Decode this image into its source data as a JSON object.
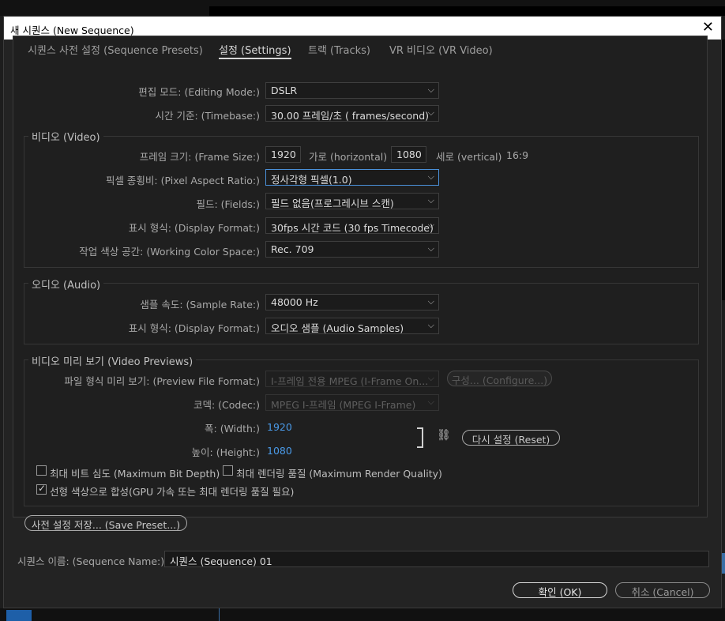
{
  "window": {
    "title": "새 시퀀스 (New Sequence)"
  },
  "tabs": [
    {
      "label": "시퀀스 사전 설정 (Sequence Presets)",
      "active": false
    },
    {
      "label": "설정 (Settings)",
      "active": true
    },
    {
      "label": "트랙 (Tracks)",
      "active": false
    },
    {
      "label": "VR 비디오 (VR Video)",
      "active": false
    }
  ],
  "general": {
    "editing_mode_label": "편집 모드: (Editing Mode:)",
    "editing_mode_value": "DSLR",
    "timebase_label": "시간 기준: (Timebase:)",
    "timebase_value": "30.00 프레임/초 ( frames/second)"
  },
  "video": {
    "title": "비디오 (Video)",
    "frame_size_label": "프레임 크기: (Frame Size:)",
    "frame_width": "1920",
    "horizontal_label": "가로 (horizontal)",
    "frame_height": "1080",
    "vertical_label": "세로 (vertical)",
    "aspect": "16:9",
    "par_label": "픽셀 종횡비: (Pixel Aspect Ratio:)",
    "par_value": "정사각형 픽셀(1.0)",
    "fields_label": "필드: (Fields:)",
    "fields_value": "필드 없음(프로그레시브 스캔)",
    "display_format_label": "표시 형식: (Display Format:)",
    "display_format_value": "30fps 시간 코드 (30 fps Timecode)",
    "color_space_label": "작업 색상 공간: (Working Color Space:)",
    "color_space_value": "Rec. 709"
  },
  "audio": {
    "title": "오디오 (Audio)",
    "sample_rate_label": "샘플 속도: (Sample Rate:)",
    "sample_rate_value": "48000 Hz",
    "display_format_label": "표시 형식: (Display Format:)",
    "display_format_value": "오디오 샘플 (Audio Samples)"
  },
  "previews": {
    "title": "비디오 미리 보기 (Video Previews)",
    "file_format_label": "파일 형식 미리 보기: (Preview File Format:)",
    "file_format_value": "I-프레임 전용 MPEG (I-Frame On...",
    "configure_label": "구성... (Configure...)",
    "codec_label": "코덱: (Codec:)",
    "codec_value": "MPEG I-프레임 (MPEG I-Frame)",
    "width_label": "폭: (Width:)",
    "width_value": "1920",
    "height_label": "높이: (Height:)",
    "height_value": "1080",
    "reset_label": "다시 설정 (Reset)"
  },
  "options": {
    "max_bit_depth": {
      "label": "최대 비트 심도 (Maximum Bit Depth)",
      "checked": false
    },
    "max_render_quality": {
      "label": "최대 렌더링 품질 (Maximum Render Quality)",
      "checked": false
    },
    "linear_color": {
      "label": "선형 색상으로 합성(GPU 가속 또는 최대 렌더링 품질 필요)",
      "checked": true
    }
  },
  "save_preset_label": "사전 설정 저장... (Save Preset...)",
  "sequence_name_label": "시퀀스 이름: (Sequence Name:)",
  "sequence_name_value": "시퀀스 (Sequence) 01",
  "ok_label": "확인 (OK)",
  "cancel_label": "취소 (Cancel)"
}
